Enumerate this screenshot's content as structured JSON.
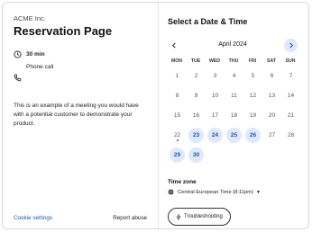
{
  "left": {
    "company": "ACME Inc.",
    "title": "Reservation Page",
    "duration": "30 min",
    "location": "Phone call",
    "description": "This is an example of a meeting you would have with a potential customer to demonstrate your product.",
    "cookie_link": "Cookie settings",
    "report_link": "Report abuse",
    "icons": [
      "clock-icon",
      "phone-icon"
    ]
  },
  "calendar": {
    "title": "Select a Date & Time",
    "month": "April 2024",
    "prev_icon": "chevron-left-icon",
    "next_icon": "chevron-right-icon",
    "weekdays": [
      "MON",
      "TUE",
      "WED",
      "THU",
      "FRI",
      "SAT",
      "SUN"
    ],
    "first_weekday": 0,
    "days_in_month": 30,
    "today": 22,
    "available_days": [
      23,
      24,
      25,
      26,
      29,
      30
    ],
    "accent_color": "#1a56c4",
    "available_bg": "#dfe9f9"
  },
  "timezone": {
    "label": "Time zone",
    "value": "Central European Time (8:11pm)",
    "icon": "globe-icon"
  },
  "troubleshoot": {
    "label": "Troubleshooting",
    "icon": "bolt-icon"
  }
}
